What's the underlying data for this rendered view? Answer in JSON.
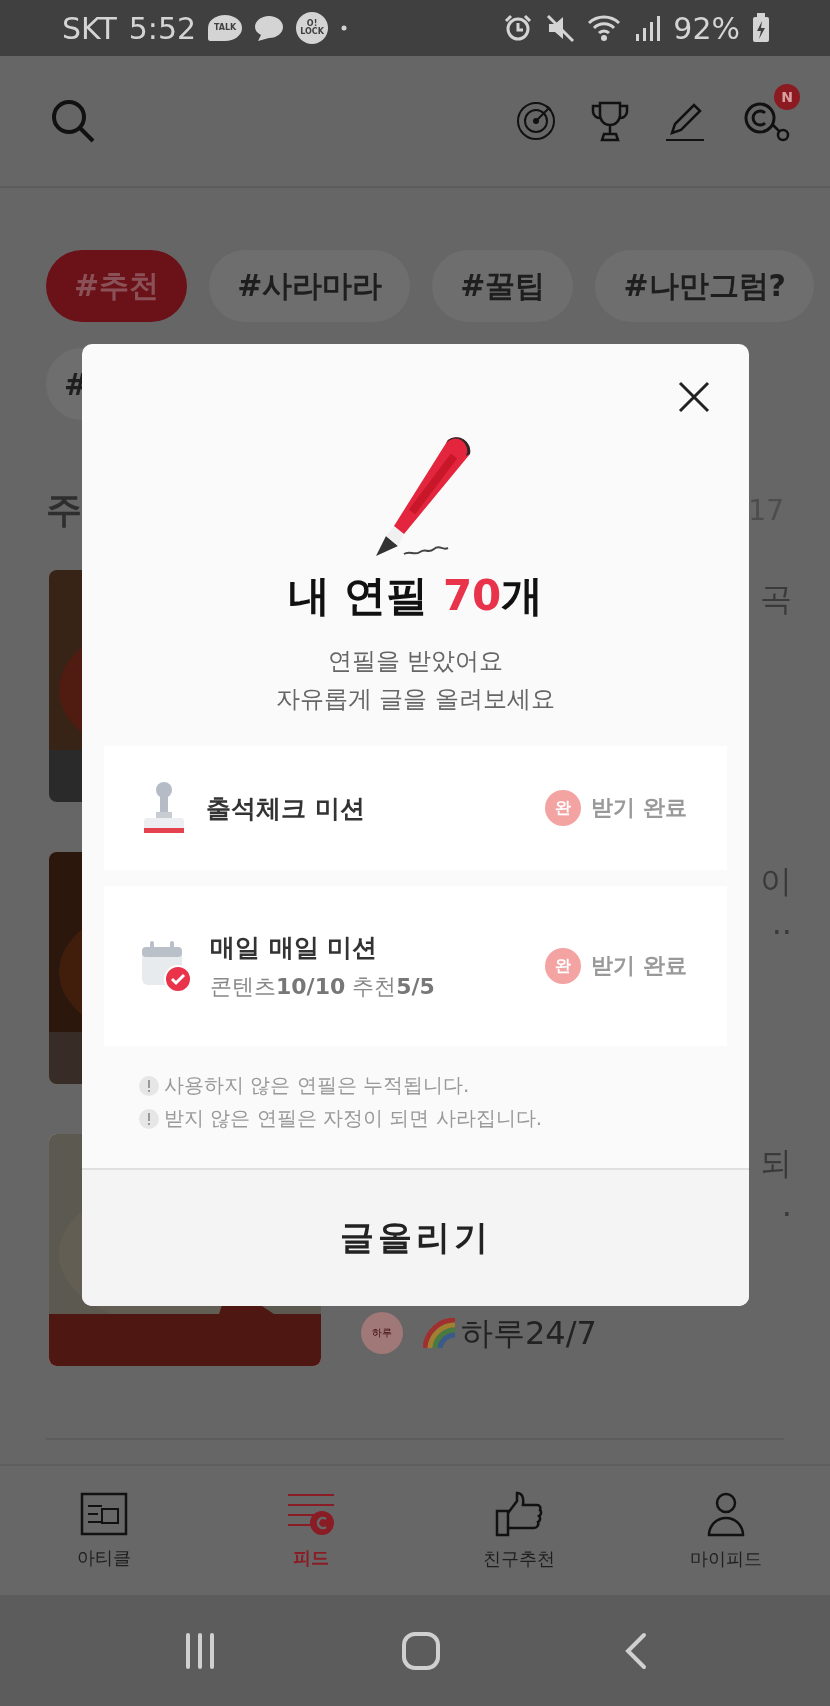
{
  "status_bar": {
    "carrier": "SKT",
    "time": "5:52",
    "notifications": [
      {
        "kind": "talk",
        "label": "TALK"
      },
      {
        "kind": "chat"
      },
      {
        "kind": "lock",
        "label": "O! LOCK"
      },
      {
        "kind": "more"
      }
    ],
    "battery": "92%"
  },
  "header": {
    "badge": "N"
  },
  "chips": [
    {
      "label": "#추천",
      "selected": true
    },
    {
      "label": "#사라마라",
      "selected": false
    },
    {
      "label": "#꿀팁",
      "selected": false
    },
    {
      "label": "#나만그럼?",
      "selected": false
    },
    {
      "label": "#",
      "selected": false
    }
  ],
  "section": {
    "title": "주",
    "count": "17"
  },
  "posts": [
    {
      "kind": "picture",
      "lines": [
        "곡"
      ]
    },
    {
      "kind": "picture",
      "lines": [
        "이",
        ".."
      ]
    },
    {
      "kind": "picture",
      "lines": [
        "되",
        "."
      ],
      "author": {
        "avatar": "하루",
        "name": "하루24/7"
      }
    }
  ],
  "modal": {
    "title_prefix": "내 연필 ",
    "count": "70",
    "title_suffix": "개",
    "message": [
      "연필을 받았어요",
      "자유롭게 글을 올려보세요"
    ],
    "missions": [
      {
        "kind": "stamp",
        "title": "출석체크 미션",
        "badge": "완",
        "status": "받기 완료",
        "completed": true
      },
      {
        "kind": "calendar",
        "title": "매일 매일 미션",
        "detail": "콘텐츠**10/10**  추천**5/5**",
        "badge": "완",
        "status": "받기 완료",
        "completed": true
      }
    ],
    "notes": [
      "사용하지 않은 연필은 누적됩니다.",
      "받지 않은 연필은 자정이 되면 사라집니다."
    ],
    "action": "글올리기"
  },
  "bottom_nav": [
    {
      "kind": "article",
      "label": "아티클",
      "selected": false
    },
    {
      "kind": "feed",
      "label": "피드",
      "selected": true
    },
    {
      "kind": "thumb",
      "label": "친구추천",
      "selected": false
    },
    {
      "kind": "person",
      "label": "마이피드",
      "selected": false
    }
  ]
}
